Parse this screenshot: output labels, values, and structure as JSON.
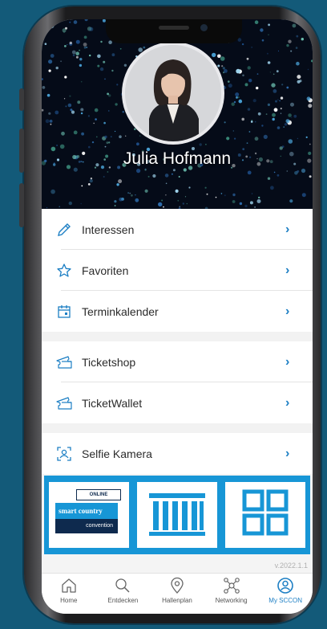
{
  "profile": {
    "name": "Julia Hofmann"
  },
  "menu": {
    "items": [
      {
        "label": "Interessen",
        "icon": "pencil-icon"
      },
      {
        "label": "Favoriten",
        "icon": "star-icon"
      },
      {
        "label": "Terminkalender",
        "icon": "calendar-icon"
      },
      {
        "label": "Ticketshop",
        "icon": "ticket-icon"
      },
      {
        "label": "TicketWallet",
        "icon": "ticket-icon"
      },
      {
        "label": "Selfie Kamera",
        "icon": "selfie-camera-icon"
      }
    ]
  },
  "banner": {
    "online_label": "ONLINE",
    "smart_label": "smart country",
    "convention_label": "convention"
  },
  "version": "v.2022.1.1",
  "tabs": [
    {
      "label": "Home",
      "icon": "home-icon"
    },
    {
      "label": "Entdecken",
      "icon": "search-icon"
    },
    {
      "label": "Hallenplan",
      "icon": "location-pin-icon"
    },
    {
      "label": "Networking",
      "icon": "network-icon"
    },
    {
      "label": "My SCCON",
      "icon": "user-circle-icon"
    }
  ],
  "colors": {
    "accent": "#1d7fc4",
    "banner": "#1796d6",
    "navy": "#0e2a4e"
  }
}
